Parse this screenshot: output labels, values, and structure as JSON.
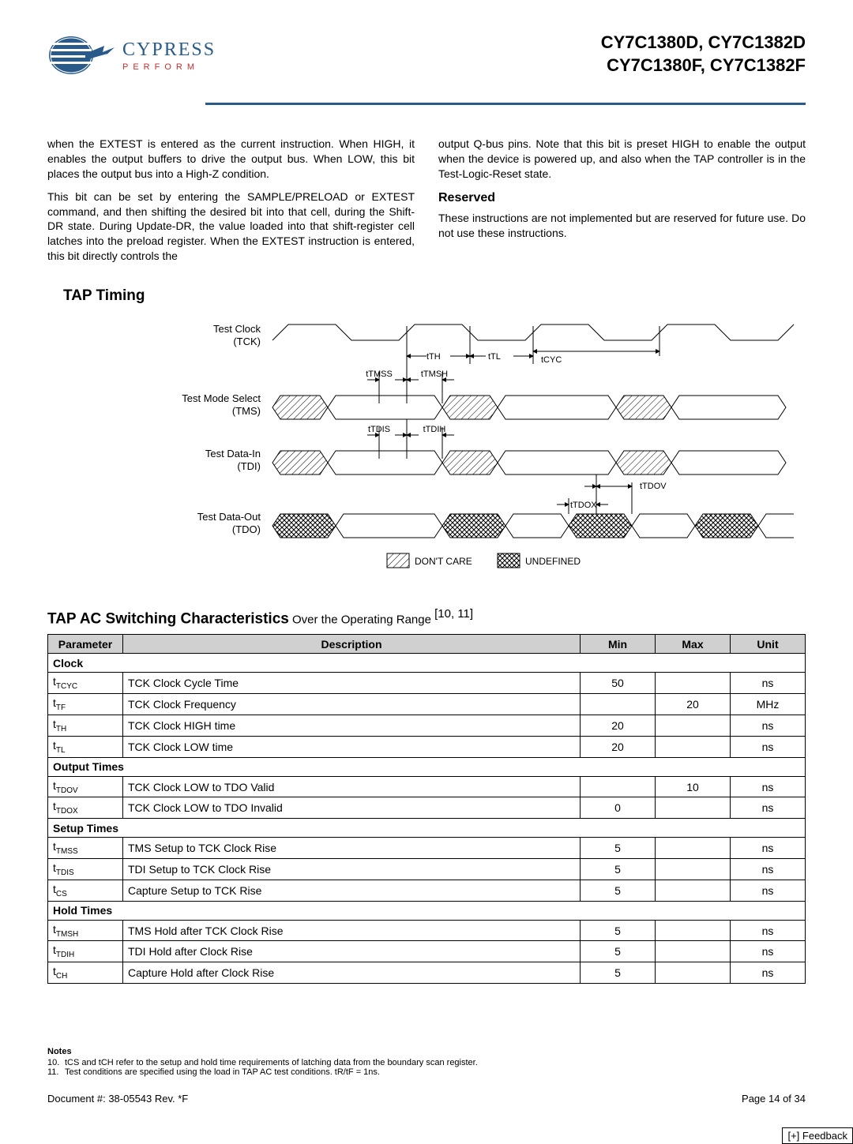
{
  "header": {
    "logo_main": "CYPRESS",
    "logo_sub": "PERFORM",
    "title_line1": "CY7C1380D, CY7C1382D",
    "title_line2": "CY7C1380F, CY7C1382F"
  },
  "body": {
    "left_p1": "when the EXTEST is entered as the current instruction. When HIGH, it enables the output buffers to drive the output bus. When LOW, this bit places the output bus into a High-Z condition.",
    "left_p2": "This bit can be set by entering the SAMPLE/PRELOAD or EXTEST command, and then shifting the desired bit into that cell, during the Shift-DR state. During Update-DR, the value loaded into that shift-register cell latches into the preload register. When the EXTEST instruction is entered, this bit directly controls the",
    "right_p1": "output Q-bus pins. Note that this bit is preset HIGH to enable the output when the device is powered up, and also when the TAP controller is in the Test-Logic-Reset state.",
    "reserved_h": "Reserved",
    "right_p2": "These instructions are not implemented but are reserved for future use. Do not use these instructions."
  },
  "tap_timing_h": "TAP Timing",
  "timing": {
    "tck": "Test Clock",
    "tck_sub": "(TCK)",
    "tms": "Test Mode Select",
    "tms_sub": "(TMS)",
    "tdi": "Test Data-In",
    "tdi_sub": "(TDI)",
    "tdo": "Test Data-Out",
    "tdo_sub": "(TDO)",
    "t_th": "tTH",
    "t_tl": "tTL",
    "t_cyc": "tCYC",
    "t_tmss": "tTMSS",
    "t_tmsh": "tTMSH",
    "t_tdis": "tTDIS",
    "t_tdih": "tTDIH",
    "t_tdov": "tTDOV",
    "t_tdox": "tTDOX",
    "legend_dc": "DON'T CARE",
    "legend_undef": "UNDEFINED"
  },
  "table": {
    "title": "TAP AC Switching Characteristics",
    "title_suffix": " Over the Operating Range ",
    "title_refs": "[10, 11]",
    "cols": {
      "param": "Parameter",
      "desc": "Description",
      "min": "Min",
      "max": "Max",
      "unit": "Unit"
    },
    "groups": [
      {
        "name": "Clock",
        "rows": [
          {
            "param": "tTCYC",
            "desc": "TCK Clock Cycle Time",
            "min": "50",
            "max": "",
            "unit": "ns"
          },
          {
            "param": "tTF",
            "desc": "TCK Clock Frequency",
            "min": "",
            "max": "20",
            "unit": "MHz"
          },
          {
            "param": "tTH",
            "desc": "TCK Clock HIGH time",
            "min": "20",
            "max": "",
            "unit": "ns"
          },
          {
            "param": "tTL",
            "desc": "TCK Clock LOW time",
            "min": "20",
            "max": "",
            "unit": "ns"
          }
        ]
      },
      {
        "name": "Output Times",
        "rows": [
          {
            "param": "tTDOV",
            "desc": "TCK Clock LOW to TDO Valid",
            "min": "",
            "max": "10",
            "unit": "ns"
          },
          {
            "param": "tTDOX",
            "desc": "TCK Clock LOW to TDO Invalid",
            "min": "0",
            "max": "",
            "unit": "ns"
          }
        ]
      },
      {
        "name": "Setup Times",
        "rows": [
          {
            "param": "tTMSS",
            "desc": "TMS Setup to TCK Clock Rise",
            "min": "5",
            "max": "",
            "unit": "ns"
          },
          {
            "param": "tTDIS",
            "desc": "TDI Setup to TCK Clock Rise",
            "min": "5",
            "max": "",
            "unit": "ns"
          },
          {
            "param": "tCS",
            "desc": "Capture Setup to TCK Rise",
            "min": "5",
            "max": "",
            "unit": "ns"
          }
        ]
      },
      {
        "name": "Hold Times",
        "rows": [
          {
            "param": "tTMSH",
            "desc": "TMS Hold after TCK Clock Rise",
            "min": "5",
            "max": "",
            "unit": "ns"
          },
          {
            "param": "tTDIH",
            "desc": "TDI Hold after Clock Rise",
            "min": "5",
            "max": "",
            "unit": "ns"
          },
          {
            "param": "tCH",
            "desc": "Capture Hold after Clock Rise",
            "min": "5",
            "max": "",
            "unit": "ns"
          }
        ]
      }
    ]
  },
  "notes": {
    "h": "Notes",
    "n10": "tCS and tCH refer to the setup and hold time requirements of latching data from the boundary scan register.",
    "n11": "Test conditions are specified using the load in TAP AC test conditions. tR/tF = 1ns."
  },
  "footer": {
    "doc": "Document #: 38-05543 Rev. *F",
    "page": "Page 14 of 34",
    "feedback": "[+] Feedback"
  }
}
